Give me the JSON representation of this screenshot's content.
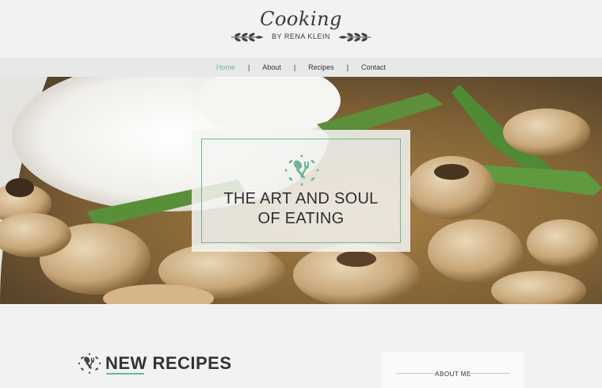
{
  "brand": {
    "title": "Cooking",
    "subtitle": "BY RENA KLEIN"
  },
  "nav": {
    "items": [
      {
        "label": "Home",
        "active": true
      },
      {
        "label": "About"
      },
      {
        "label": "Recipes"
      },
      {
        "label": "Contact"
      }
    ],
    "separator": "|"
  },
  "hero": {
    "line1": "THE ART AND SOUL",
    "line2": "OF EATING"
  },
  "main": {
    "section_title": "NEW RECIPES"
  },
  "sidebar": {
    "heading": "ABOUT ME"
  },
  "colors": {
    "accent": "#6fb59a",
    "background": "#f2f2f2",
    "nav_bg": "#e8e8e8"
  },
  "icons": {
    "logo_decoration": "leaf-sprig-icon",
    "hero": "spoon-fork-icon",
    "section": "spoon-fork-icon"
  }
}
